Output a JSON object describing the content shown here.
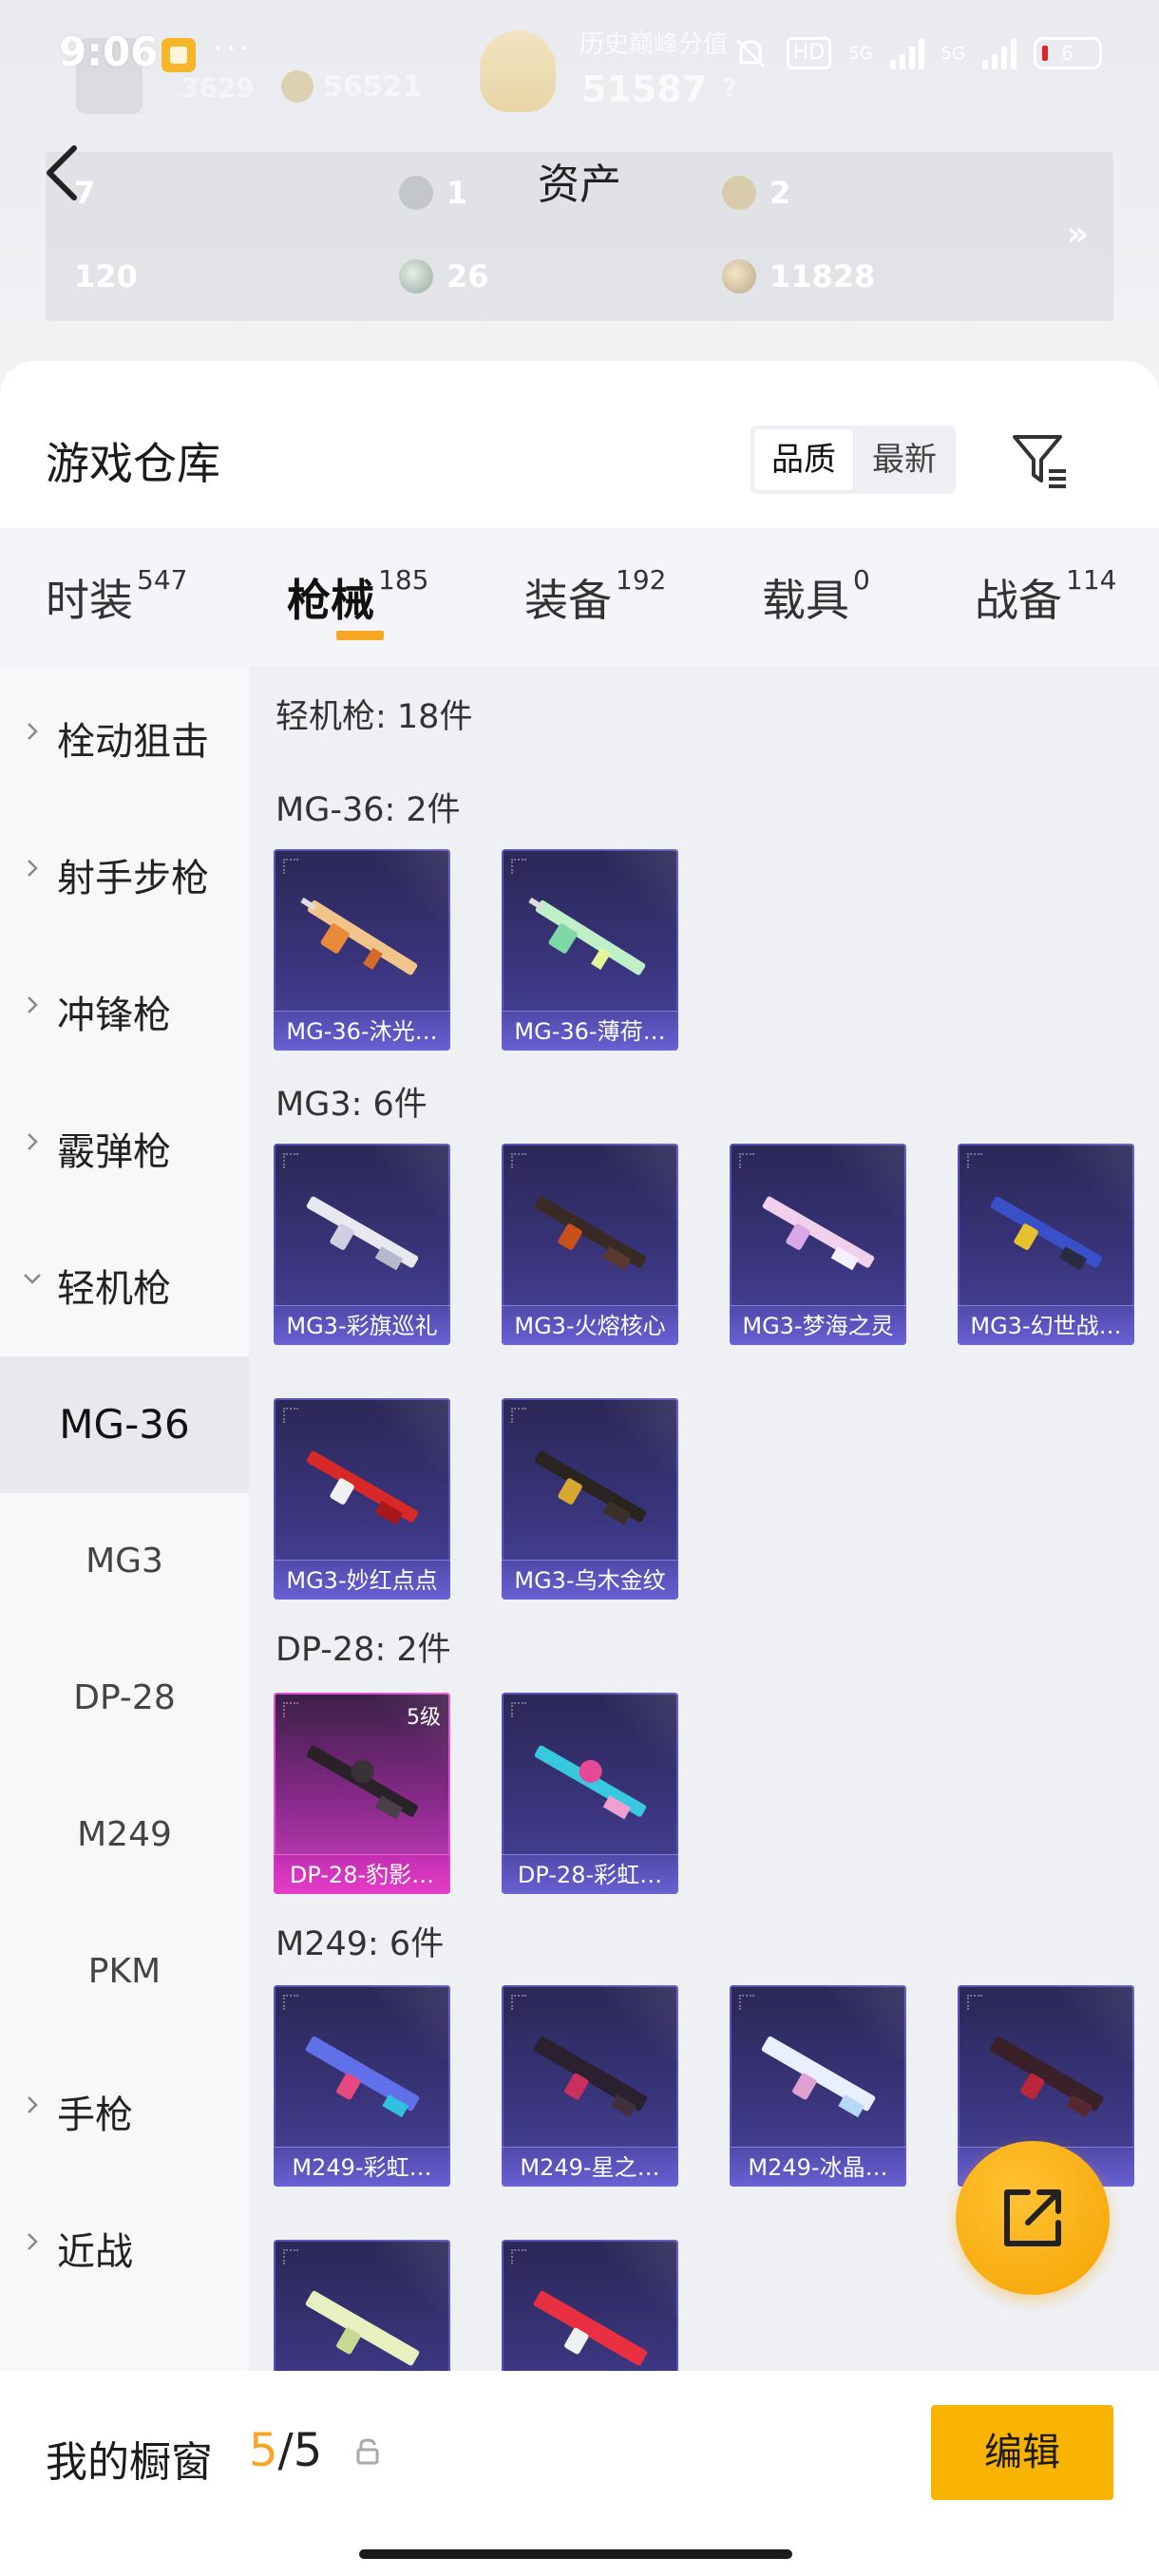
{
  "status_bar": {
    "time": "9:06",
    "dots": "···",
    "hd": "HD",
    "net1": "5G",
    "net2": "5G",
    "battery": "6"
  },
  "background_stats": {
    "ghost_text_1": "历史巅峰分值",
    "ghost_value_1": "51587",
    "ghost_value_2": "56521",
    "ghost_value_3": "3629",
    "ghost_value_4": "?"
  },
  "assets": {
    "title": "资产",
    "items": [
      {
        "icon": "card-icon",
        "value": "7"
      },
      {
        "icon": "coin-s-icon",
        "value": "1"
      },
      {
        "icon": "coin-a-icon",
        "value": "2"
      },
      {
        "icon": "ticket-icon",
        "value": "120"
      },
      {
        "icon": "orb-icon",
        "value": "26"
      },
      {
        "icon": "gold-coin-icon",
        "value": "11828"
      }
    ],
    "more": "»"
  },
  "warehouse": {
    "title": "游戏仓库",
    "sort_quality": "品质",
    "sort_newest": "最新"
  },
  "tabs": [
    {
      "label": "时装",
      "count": "547"
    },
    {
      "label": "枪械",
      "count": "185"
    },
    {
      "label": "装备",
      "count": "192"
    },
    {
      "label": "载具",
      "count": "0"
    },
    {
      "label": "战备",
      "count": "114"
    }
  ],
  "categories": {
    "c1": "栓动狙击",
    "c2": "射手步枪",
    "c3": "冲锋枪",
    "c4": "霰弹枪",
    "c5": "轻机枪",
    "s1": "MG-36",
    "s2": "MG3",
    "s3": "DP-28",
    "s4": "M249",
    "s5": "PKM",
    "c6": "手枪",
    "c7": "近战"
  },
  "content": {
    "group_title": "轻机枪: 18件",
    "sections": [
      {
        "title": "MG-36: 2件",
        "items": [
          "MG-36-沐光…",
          "MG-36-薄荷…"
        ]
      },
      {
        "title": "MG3: 6件",
        "items": [
          "MG3-彩旗巡礼",
          "MG3-火熔核心",
          "MG3-梦海之灵",
          "MG3-幻世战…",
          "MG3-妙红点点",
          "MG3-乌木金纹"
        ]
      },
      {
        "title": "DP-28: 2件",
        "items": [
          "DP-28-豹影…",
          "DP-28-彩虹…"
        ],
        "level": "5级"
      },
      {
        "title": "M249: 6件",
        "items": [
          "M249-彩虹…",
          "M249-星之…",
          "M249-冰晶…",
          "M249-…"
        ]
      }
    ]
  },
  "showcase": {
    "label": "我的橱窗",
    "current": "5",
    "sep": "/",
    "total": "5",
    "edit": "编辑"
  },
  "colors": {
    "accent": "#f5a623",
    "button": "#f8b400",
    "item_bg": "#39347a",
    "item_pink": "#d040c0"
  }
}
